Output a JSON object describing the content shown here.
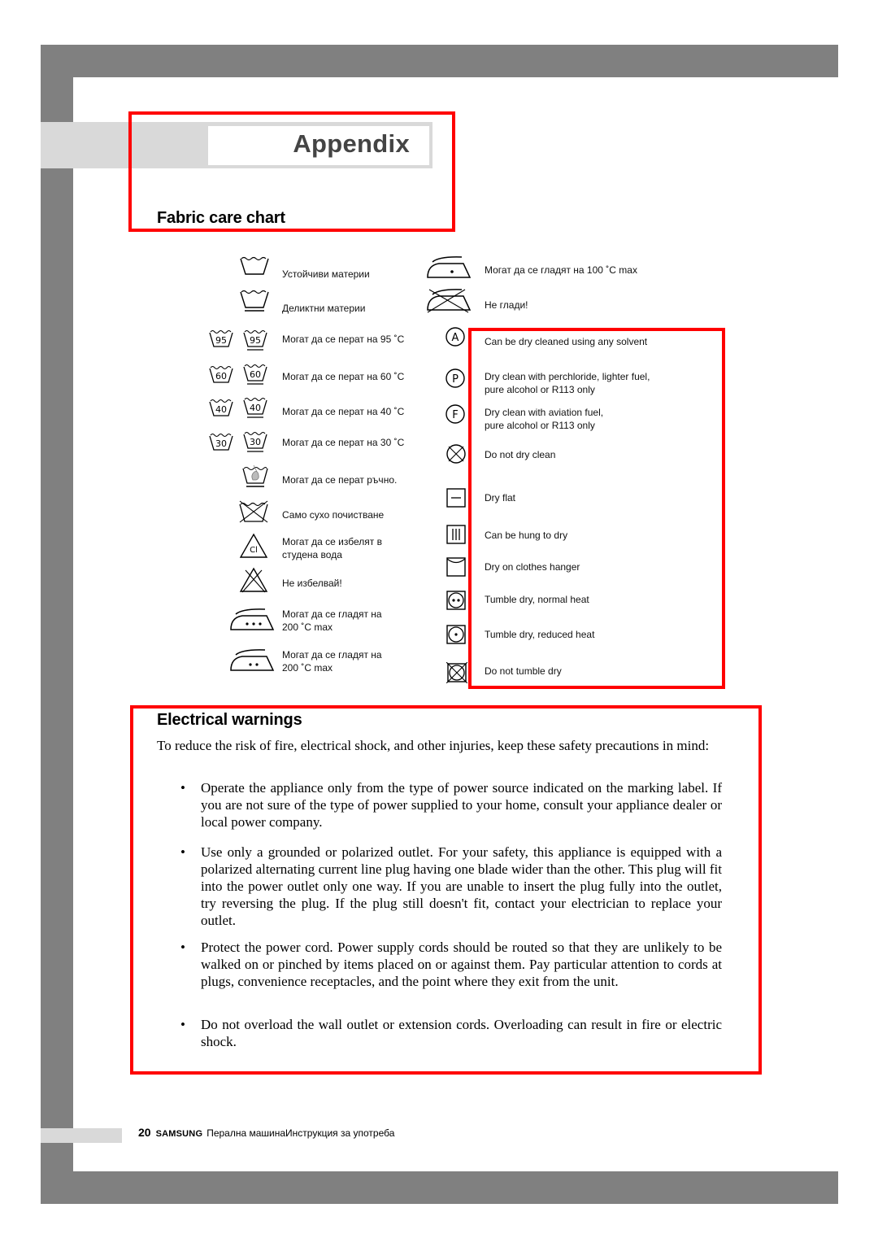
{
  "header": {
    "title": "Appendix"
  },
  "fabric_care": {
    "heading": "Fabric care chart",
    "left_column": [
      {
        "icon": "wash-tub-icon",
        "label": "Устойчиви материи"
      },
      {
        "icon": "wash-tub-delicate-icon",
        "label": "Деликтни материи"
      },
      {
        "icon": "wash-95-icon",
        "label": "Могат да се перат на 95 ˚C",
        "temp": "95"
      },
      {
        "icon": "wash-60-icon",
        "label": "Могат да се перат на 60 ˚C",
        "temp": "60"
      },
      {
        "icon": "wash-40-icon",
        "label": "Могат да се перат на 40 ˚C",
        "temp": "40"
      },
      {
        "icon": "wash-30-icon",
        "label": "Могат да се перат на 30 ˚C",
        "temp": "30"
      },
      {
        "icon": "hand-wash-icon",
        "label": "Могат да се перат ръчно."
      },
      {
        "icon": "do-not-wash-icon",
        "label": "Само сухо почистване"
      },
      {
        "icon": "bleach-cl-icon",
        "label_line1": "Могат да се избелят в",
        "label_line2": "студена вода",
        "glyph": "Cl"
      },
      {
        "icon": "do-not-bleach-icon",
        "label": "Не избелвай!"
      },
      {
        "icon": "iron-three-dots-icon",
        "label_line1": "Могат да се гладят на",
        "label_line2": "200 ˚C max"
      },
      {
        "icon": "iron-two-dots-icon",
        "label_line1": "Могат да се гладят на",
        "label_line2": "200 ˚C max"
      }
    ],
    "right_column": [
      {
        "icon": "iron-one-dot-icon",
        "label": "Могат да се гладят на 100 ˚C max"
      },
      {
        "icon": "do-not-iron-icon",
        "label": "Не глади!"
      },
      {
        "icon": "dry-clean-a-icon",
        "label": "Can be dry cleaned using any solvent",
        "glyph": "A"
      },
      {
        "icon": "dry-clean-p-icon",
        "label_line1": "Dry clean with perchloride, lighter fuel,",
        "label_line2": "pure alcohol or R113 only",
        "glyph": "P"
      },
      {
        "icon": "dry-clean-f-icon",
        "label_line1": "Dry clean with aviation fuel,",
        "label_line2": "pure alcohol or R113 only",
        "glyph": "F"
      },
      {
        "icon": "do-not-dry-clean-icon",
        "label": "Do not dry clean"
      },
      {
        "icon": "dry-flat-icon",
        "label": "Dry flat"
      },
      {
        "icon": "hang-dry-icon",
        "label": "Can be hung to dry"
      },
      {
        "icon": "clothes-hanger-dry-icon",
        "label": "Dry on clothes hanger"
      },
      {
        "icon": "tumble-dry-normal-icon",
        "label": " Tumble dry, normal heat"
      },
      {
        "icon": "tumble-dry-reduced-icon",
        "label": "Tumble dry, reduced heat"
      },
      {
        "icon": "do-not-tumble-dry-icon",
        "label": "Do not tumble dry"
      }
    ]
  },
  "electrical": {
    "heading": "Electrical warnings",
    "intro": "To reduce the risk of fire, electrical shock, and other injuries, keep these safety precautions in mind:",
    "bullets": [
      "Operate the appliance only from the type of power source indicated on the marking label.  If you are not sure of the type of power supplied to your home, consult your appliance dealer or local power company.",
      "Use only a grounded or polarized outlet.  For your safety, this appliance is equipped with a polarized alternating current line plug having one blade wider than the other. This plug will fit into the power outlet only one way.  If you are unable to insert the plug fully into the outlet, try reversing the plug.  If the plug still doesn't fit, contact your electrician to replace your outlet.",
      "Protect the power cord. Power supply cords should be routed so that they are unlikely to be walked on or pinched by items placed on or against them.  Pay particular attention to cords at plugs, convenience receptacles, and the point where they exit from the unit.",
      "Do not overload the wall outlet or extension cords.  Overloading can result in fire or electric shock."
    ],
    "bullet_char": "•"
  },
  "footer": {
    "page_number": "20",
    "brand": "SAMSUNG",
    "text": "Перална машинаИнструкция за употреба"
  },
  "colors": {
    "frame_gray": "#808080",
    "strip_gray": "#d9d9d9",
    "highlight_red": "#ff0000",
    "title_text": "#444444"
  }
}
